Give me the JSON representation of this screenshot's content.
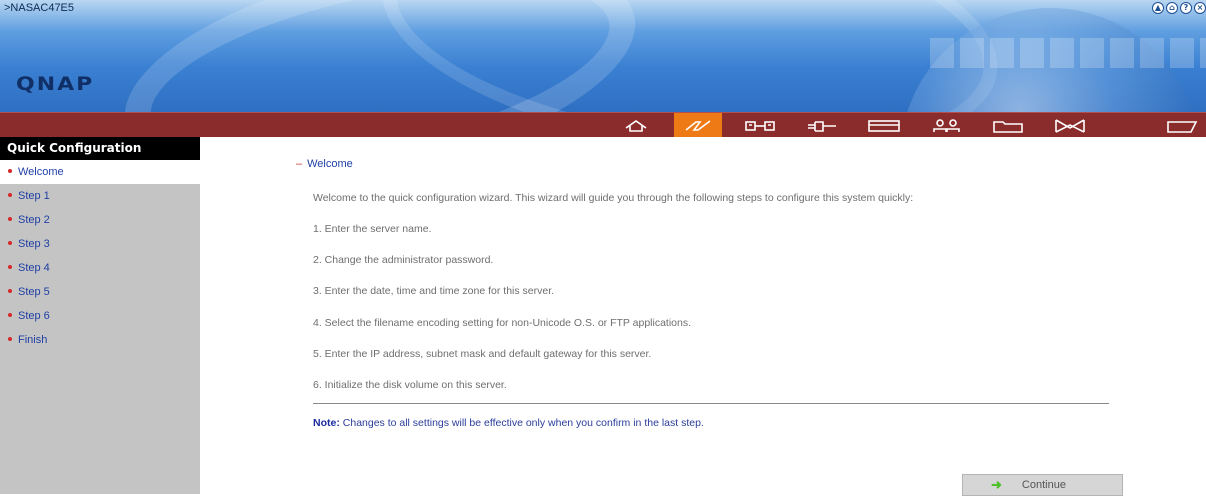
{
  "header": {
    "server_name": ">NASAC47E5",
    "logo": "QNAP",
    "top_icons": [
      "up-icon",
      "home-icon",
      "help-icon",
      "logout-icon"
    ]
  },
  "navbar": {
    "items": [
      {
        "name": "home-nav-icon",
        "active": false
      },
      {
        "name": "quick-config-nav-icon",
        "active": true
      },
      {
        "name": "system-admin-nav-icon",
        "active": false
      },
      {
        "name": "network-nav-icon",
        "active": false
      },
      {
        "name": "disk-nav-icon",
        "active": false
      },
      {
        "name": "users-nav-icon",
        "active": false
      },
      {
        "name": "share-folder-nav-icon",
        "active": false
      },
      {
        "name": "mail-nav-icon",
        "active": false
      },
      {
        "name": "more-nav-icon",
        "active": false
      }
    ],
    "accent_color": "#ee7a16",
    "bar_color": "#8b2c2c"
  },
  "sidebar": {
    "title": "Quick Configuration",
    "items": [
      {
        "label": "Welcome",
        "current": true
      },
      {
        "label": "Step 1",
        "current": false
      },
      {
        "label": "Step 2",
        "current": false
      },
      {
        "label": "Step 3",
        "current": false
      },
      {
        "label": "Step 4",
        "current": false
      },
      {
        "label": "Step 5",
        "current": false
      },
      {
        "label": "Step 6",
        "current": false
      },
      {
        "label": "Finish",
        "current": false
      }
    ]
  },
  "main": {
    "section_title": "Welcome",
    "intro": "Welcome to the quick configuration wizard. This wizard will guide you through the following steps to configure this system quickly:",
    "steps": [
      "1. Enter the server name.",
      "2. Change the administrator password.",
      "3. Enter the date, time and time zone for this server.",
      "4. Select the filename encoding setting for non-Unicode O.S. or FTP applications.",
      "5. Enter the IP address, subnet mask and default gateway for this server.",
      "6. Initialize the disk volume on this server."
    ],
    "note_label": "Note:",
    "note_text": "Changes to all settings will be effective only when you confirm in the last step.",
    "continue_label": "Continue"
  }
}
